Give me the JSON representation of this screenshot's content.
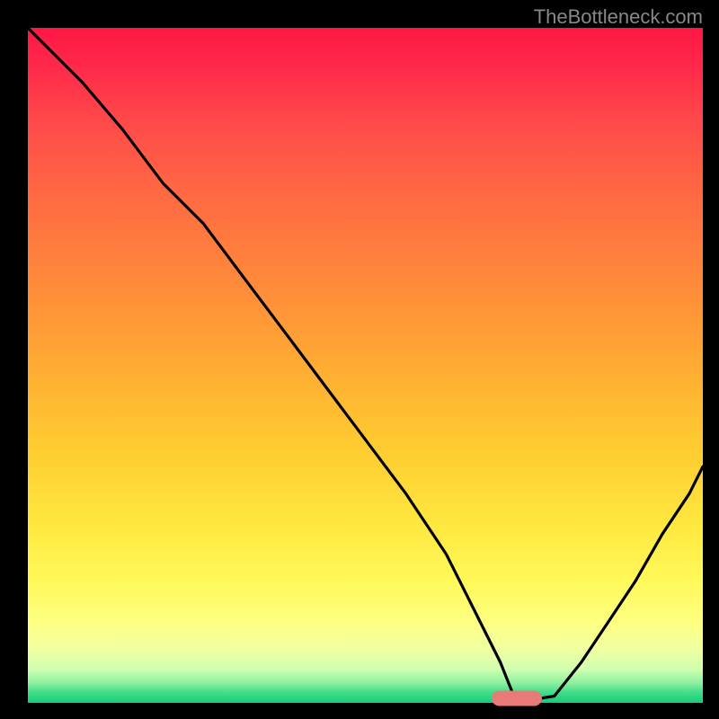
{
  "watermark": "TheBottleneck.com",
  "chart_data": {
    "type": "line",
    "title": "",
    "xlabel": "",
    "ylabel": "",
    "xlim": [
      0,
      100
    ],
    "ylim": [
      0,
      100
    ],
    "notes": "Gradient background from red (top, high bottleneck) through orange/yellow to green (bottom, low/no bottleneck). Black curve shows bottleneck percentage as a V-shape with minimum near x≈72. Small rounded marker at the trough.",
    "series": [
      {
        "name": "bottleneck-curve",
        "x": [
          0,
          8,
          14,
          20,
          26,
          32,
          38,
          44,
          50,
          56,
          62,
          66,
          70,
          72,
          75,
          78,
          82,
          86,
          90,
          94,
          98,
          100
        ],
        "y": [
          100,
          92,
          85,
          77,
          71,
          63,
          55,
          47,
          39,
          31,
          22,
          14,
          6,
          1,
          0.5,
          1,
          6,
          12,
          18,
          25,
          31,
          35
        ]
      }
    ],
    "marker": {
      "x": 72.5,
      "y": 0.6
    }
  }
}
